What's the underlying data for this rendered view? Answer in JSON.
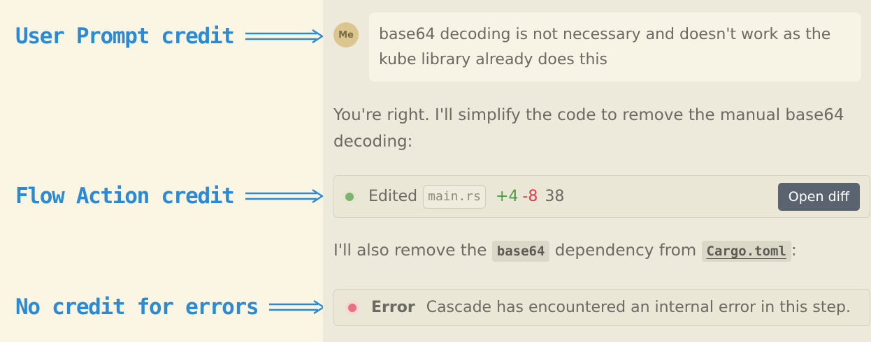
{
  "annotations": [
    {
      "label": "User Prompt credit"
    },
    {
      "label": "Flow Action credit"
    },
    {
      "label": "No credit for errors"
    }
  ],
  "colors": {
    "annotation_blue": "#2a8ad6",
    "panel_bg": "#edeadb",
    "left_bg": "#fbf5e4",
    "diff_added": "#4e9a46",
    "diff_removed": "#d8404f"
  },
  "chat": {
    "user": {
      "avatar": "Me",
      "message": "base64 decoding is not necessary and doesn't work as the kube library already does this"
    },
    "assistant_1": "You're right. I'll simplify the code to remove the manual base64 decoding:",
    "action": {
      "status_icon": "green-dot-icon",
      "label": "Edited",
      "file": "main.rs",
      "added": "+4",
      "removed": "-8",
      "lines": "38",
      "button": "Open diff"
    },
    "assistant_2": {
      "pre": "I'll also remove the",
      "code": "base64",
      "mid": "dependency from",
      "file": "Cargo.toml",
      "post": ":"
    },
    "error": {
      "status_icon": "red-dot-icon",
      "label": "Error",
      "message": "Cascade has encountered an internal error in this step."
    }
  }
}
